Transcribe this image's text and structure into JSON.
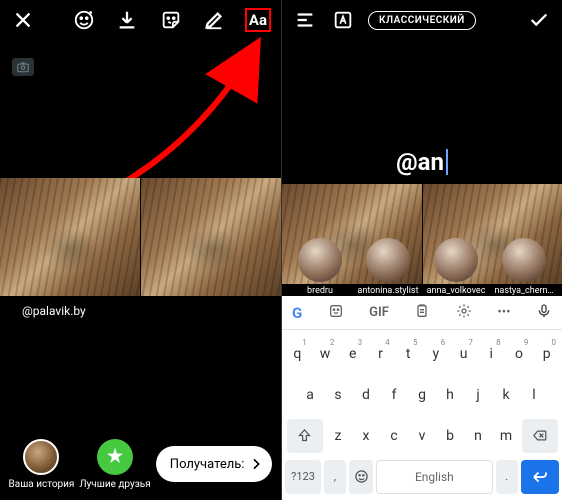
{
  "left": {
    "toolbar": {
      "close": "close-icon",
      "effects": "effects-icon",
      "save": "download-icon",
      "sticker": "sticker-icon",
      "draw": "draw-icon",
      "text_tool": "Aa"
    },
    "attribution": "@palavik.by",
    "bottom": {
      "your_story": "Ваша история",
      "close_friends": "Лучшие друзья",
      "close_friends_glyph": "★",
      "recipient_label": "Получатель:"
    }
  },
  "right": {
    "toolbar": {
      "align": "align-icon",
      "bg": "text-bg-icon",
      "font_pill": "КЛАССИЧЕСКИЙ",
      "done": "done-icon"
    },
    "typed_text": "@an",
    "suggestions": [
      {
        "username": "bredru"
      },
      {
        "username": "antonina.stylist"
      },
      {
        "username": "anna_volkovec"
      },
      {
        "username": "nastya_chern…"
      }
    ],
    "keyboard": {
      "toolbar": {
        "gif": "GIF",
        "more": "•••"
      },
      "row1": [
        {
          "k": "q",
          "n": "1"
        },
        {
          "k": "w",
          "n": "2"
        },
        {
          "k": "e",
          "n": "3"
        },
        {
          "k": "r",
          "n": "4"
        },
        {
          "k": "t",
          "n": "5"
        },
        {
          "k": "y",
          "n": "6"
        },
        {
          "k": "u",
          "n": "7"
        },
        {
          "k": "i",
          "n": "8"
        },
        {
          "k": "o",
          "n": "9"
        },
        {
          "k": "p",
          "n": "0"
        }
      ],
      "row2": [
        {
          "k": "a"
        },
        {
          "k": "s"
        },
        {
          "k": "d"
        },
        {
          "k": "f"
        },
        {
          "k": "g"
        },
        {
          "k": "h"
        },
        {
          "k": "j"
        },
        {
          "k": "k"
        },
        {
          "k": "l"
        }
      ],
      "row3": [
        {
          "k": "z"
        },
        {
          "k": "x"
        },
        {
          "k": "c"
        },
        {
          "k": "v"
        },
        {
          "k": "b"
        },
        {
          "k": "n"
        },
        {
          "k": "m"
        }
      ],
      "row4": {
        "sym": "?123",
        "comma": ",",
        "space": "English",
        "dot": "."
      }
    }
  }
}
